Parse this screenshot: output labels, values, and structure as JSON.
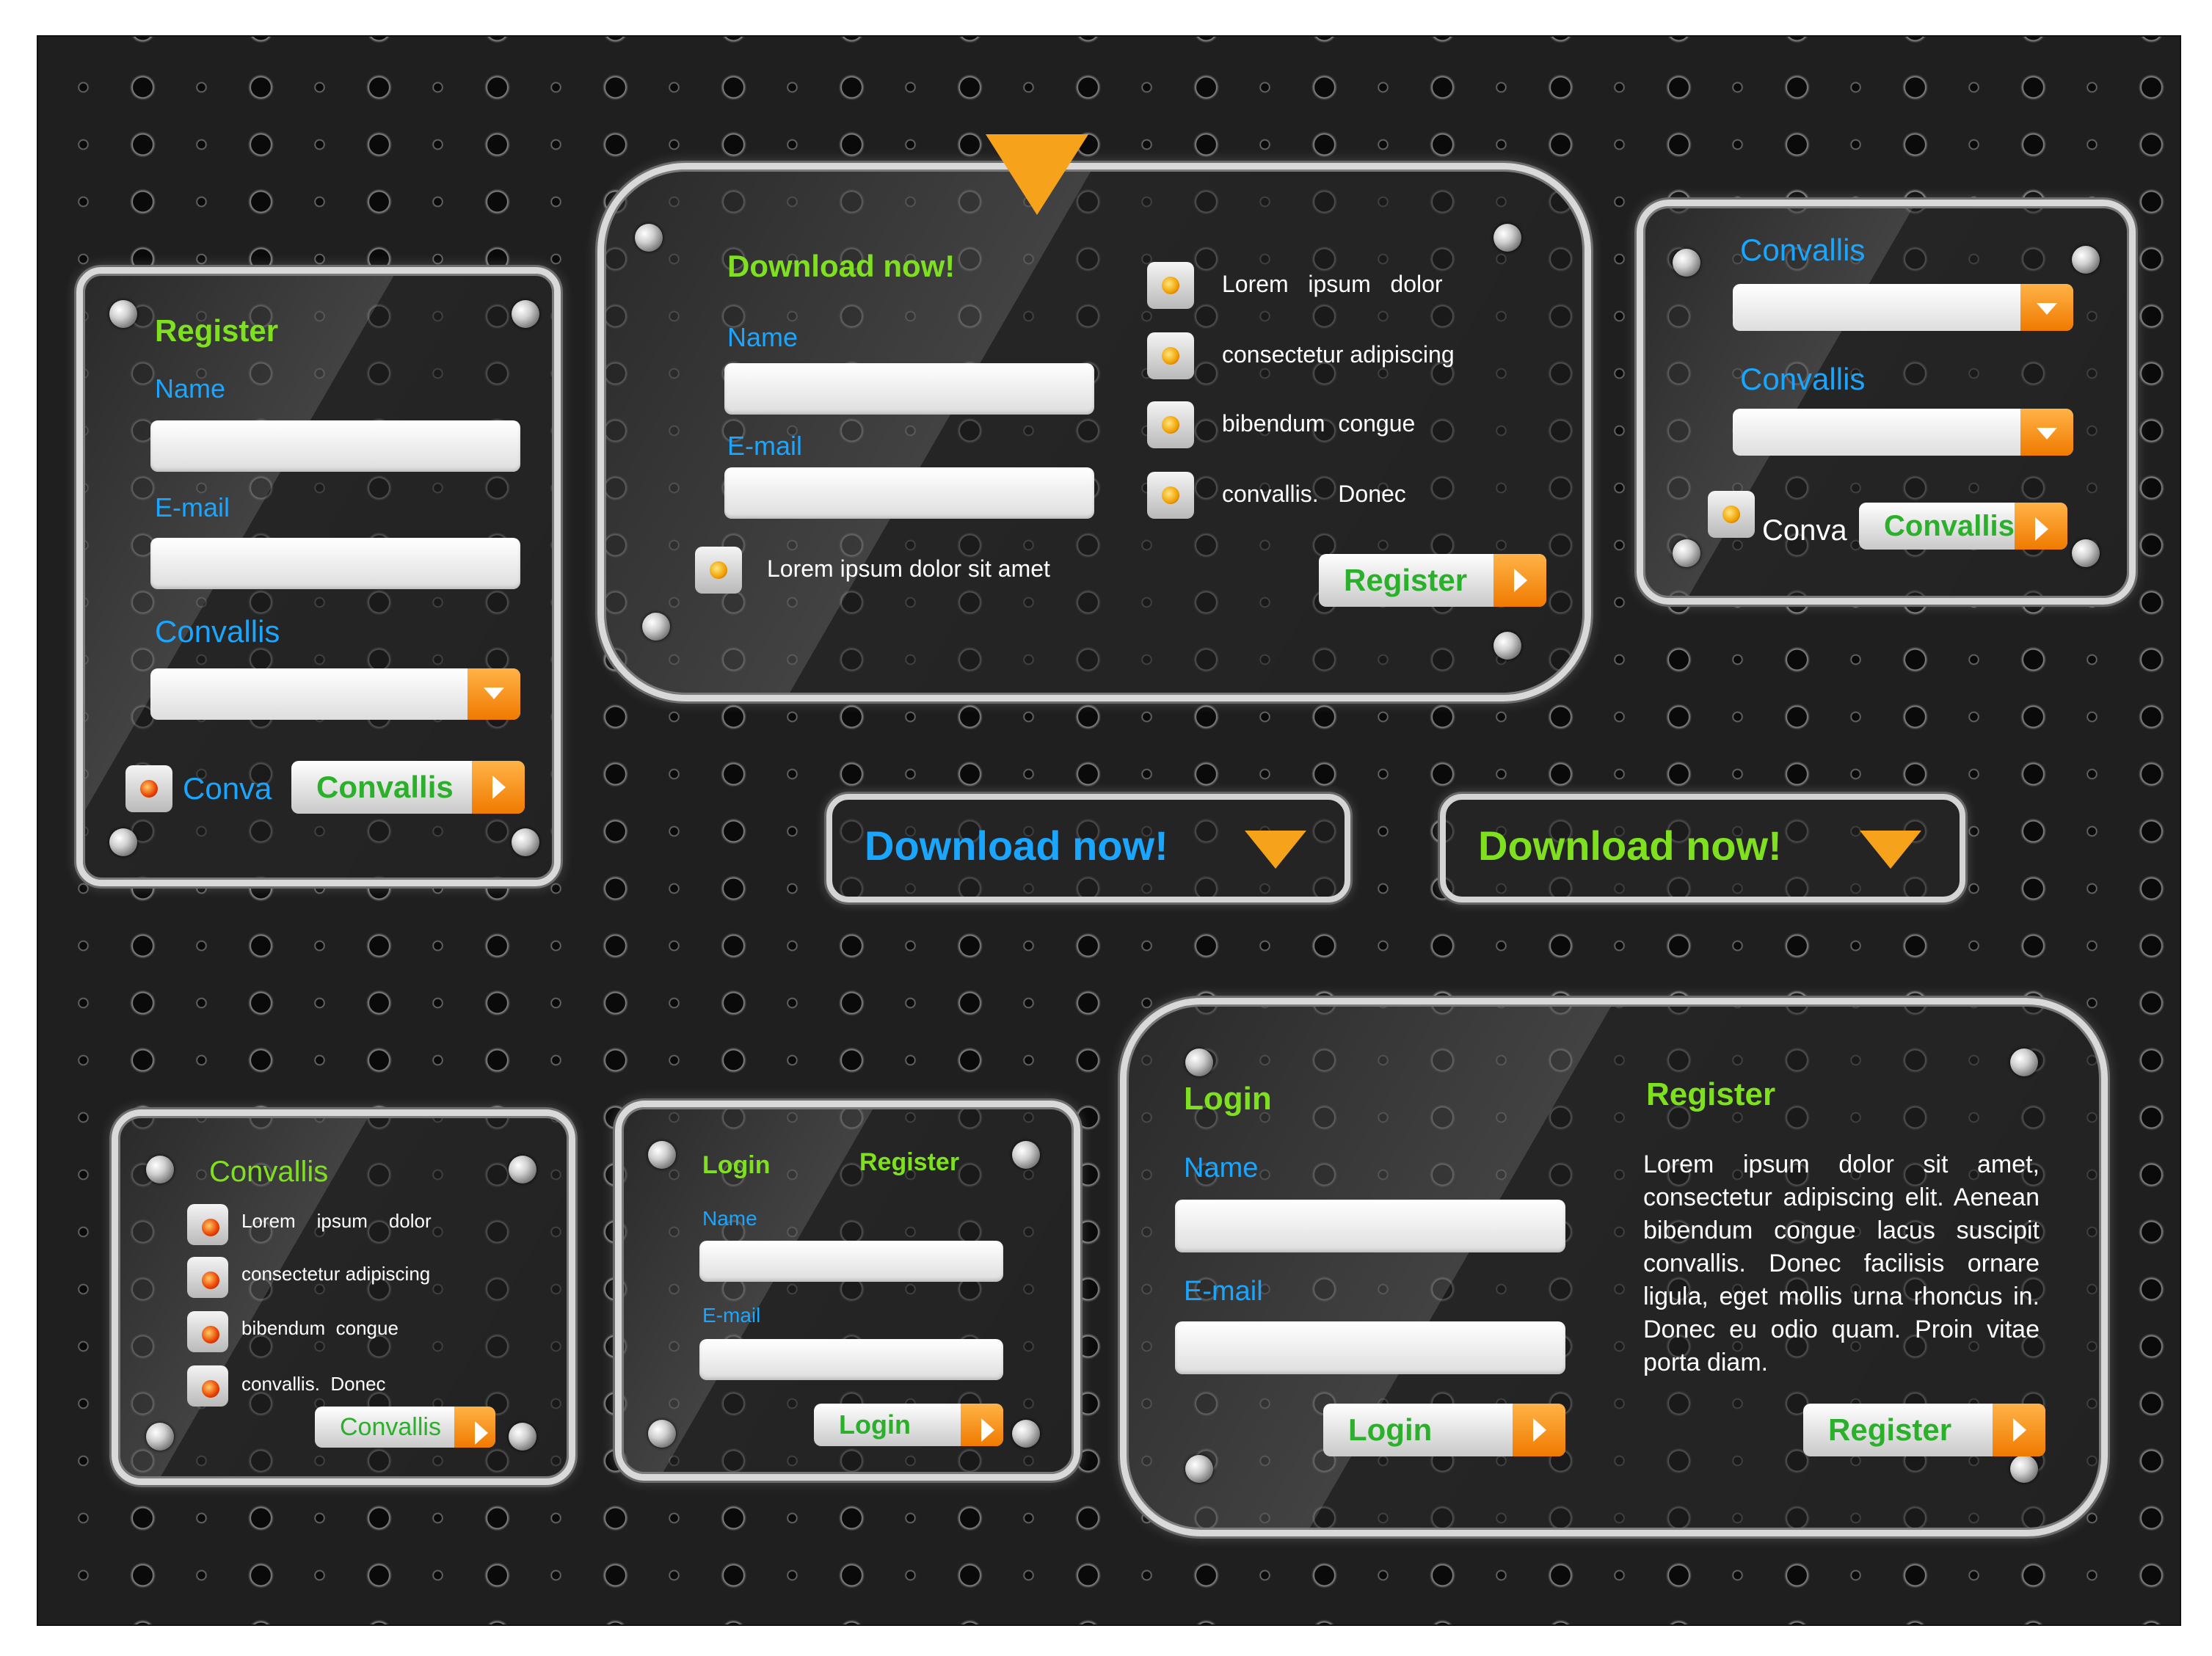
{
  "register_panel": {
    "title": "Register",
    "name_label": "Name",
    "email_label": "E-mail",
    "select_label": "Convallis",
    "radio_label": "Conva",
    "button_label": "Convallis"
  },
  "download_panel": {
    "title": "Download now!",
    "name_label": "Name",
    "email_label": "E-mail",
    "radio_label": "Lorem ipsum dolor sit amet",
    "list": [
      "Lorem   ipsum   dolor",
      "consectetur adipiscing",
      "bibendum  congue",
      "convallis.   Donec"
    ],
    "button_label": "Register"
  },
  "select_panel": {
    "select1_label": "Convallis",
    "select2_label": "Convallis",
    "radio_label": "Conva",
    "button_label": "Convallis"
  },
  "download_buttons": [
    {
      "label": "Download now!",
      "color": "#1aa6ff"
    },
    {
      "label": "Download now!",
      "color": "#7ee01f"
    }
  ],
  "list_panel": {
    "title": "Convallis",
    "list": [
      "Lorem    ipsum    dolor",
      "consectetur adipiscing",
      "bibendum  congue",
      "convallis.  Donec"
    ],
    "button_label": "Convallis"
  },
  "login_small": {
    "login_title": "Login",
    "register_title": "Register",
    "name_label": "Name",
    "email_label": "E-mail",
    "button_label": "Login"
  },
  "login_large": {
    "login_title": "Login",
    "register_title": "Register",
    "name_label": "Name",
    "email_label": "E-mail",
    "paragraph": "Lorem ipsum dolor sit amet, consectetur adipiscing elit. Aenean bibendum congue lacus suscipit convallis. Donec facilisis ornare ligula, eget mollis urna rhoncus in. Donec eu odio quam. Proin vitae porta diam.",
    "login_button": "Login",
    "register_button": "Register"
  },
  "colors": {
    "accent_green": "#7ee01f",
    "accent_blue": "#1aa6ff",
    "arrow_orange": "#f07a00"
  }
}
